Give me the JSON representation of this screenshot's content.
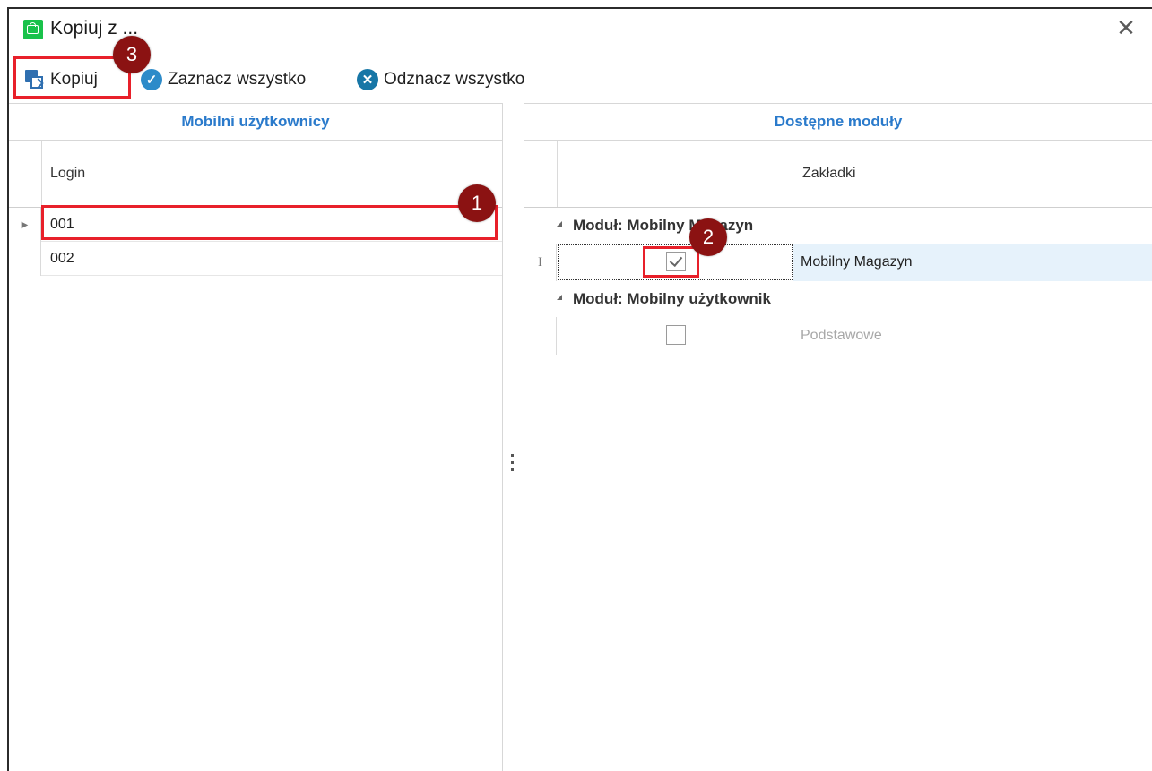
{
  "window": {
    "title": "Kopiuj z ...",
    "close_glyph": "✕"
  },
  "toolbar": {
    "copy_label": "Kopiuj",
    "select_all_label": "Zaznacz wszystko",
    "deselect_all_label": "Odznacz wszystko"
  },
  "left_panel": {
    "header": "Mobilni użytkownicy",
    "column": "Login",
    "rows": [
      "001",
      "002"
    ]
  },
  "right_panel": {
    "header": "Dostępne moduły",
    "column": "Zakładki",
    "groups": [
      {
        "label": "Moduł: Mobilny Magazyn",
        "items": [
          {
            "name": "Mobilny Magazyn",
            "checked": true
          }
        ]
      },
      {
        "label": "Moduł: Mobilny użytkownik",
        "items": [
          {
            "name": "Podstawowe",
            "checked": false
          }
        ]
      }
    ]
  },
  "annotations": [
    "1",
    "2",
    "3"
  ],
  "colors": {
    "accent": "#2a7acb",
    "highlight_box": "#e8202a",
    "badge": "#8b1212",
    "selected_row": "#e6f2fb"
  }
}
